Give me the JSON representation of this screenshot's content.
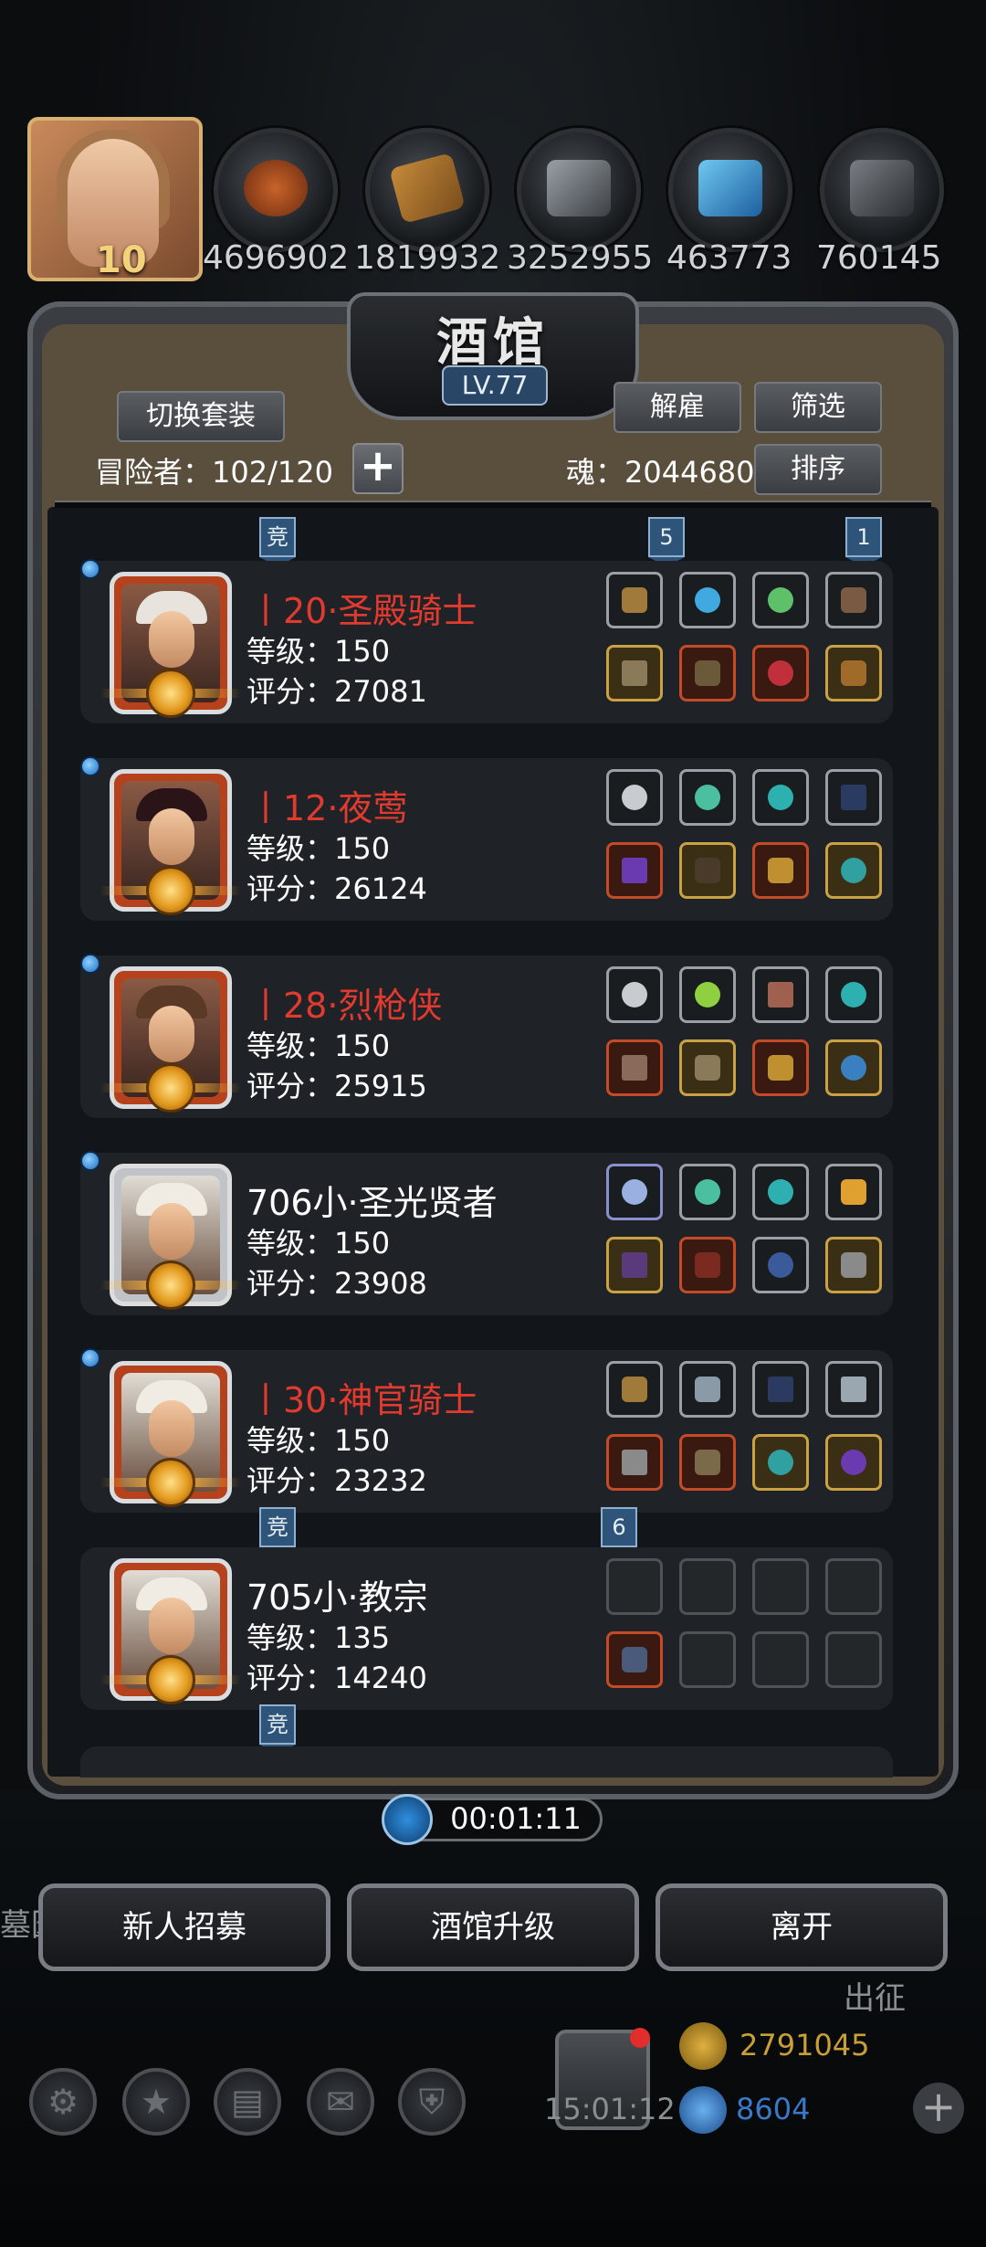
{
  "top_bar": {
    "player_level": "10",
    "resources": [
      {
        "icon": "meat-icon",
        "value": "4696902"
      },
      {
        "icon": "wood-icon",
        "value": "1819932"
      },
      {
        "icon": "iron-icon",
        "value": "3252955"
      },
      {
        "icon": "crystal-icon",
        "value": "463773"
      },
      {
        "icon": "stone-icon",
        "value": "760145"
      }
    ]
  },
  "panel": {
    "title": "酒馆",
    "level_badge": "LV.77",
    "switch_outfit": "切换套装",
    "dismiss": "解雇",
    "filter": "筛选",
    "sort": "排序",
    "adventurers_label": "冒险者：102/120",
    "soul_label": "魂：2044680"
  },
  "tags": {
    "compete": "竞",
    "five": "5",
    "one": "1",
    "six": "6"
  },
  "heroes": [
    {
      "name": "丨20·圣殿骑士",
      "level": "等级：150",
      "score": "评分：27081"
    },
    {
      "name": "丨12·夜莺",
      "level": "等级：150",
      "score": "评分：26124"
    },
    {
      "name": "丨28·烈枪侠",
      "level": "等级：150",
      "score": "评分：25915"
    },
    {
      "name": "706小·圣光贤者",
      "level": "等级：150",
      "score": "评分：23908"
    },
    {
      "name": "丨30·神官骑士",
      "level": "等级：150",
      "score": "评分：23232"
    },
    {
      "name": "705小·教宗",
      "level": "等级：135",
      "score": "评分：14240"
    }
  ],
  "timer": "00:01:11",
  "buttons": {
    "recruit": "新人招募",
    "upgrade": "酒馆升级",
    "leave": "离开"
  },
  "background": {
    "left_text": "墓园",
    "expedition": "出征",
    "gift_timer": "15:01:12",
    "gold": "2791045",
    "gems": "8604"
  },
  "colors": {
    "hero_name_red": "#e23a2e",
    "tag_blue": "#2e5479",
    "gold_text": "#c9a036",
    "gem_text": "#3a78c8"
  }
}
